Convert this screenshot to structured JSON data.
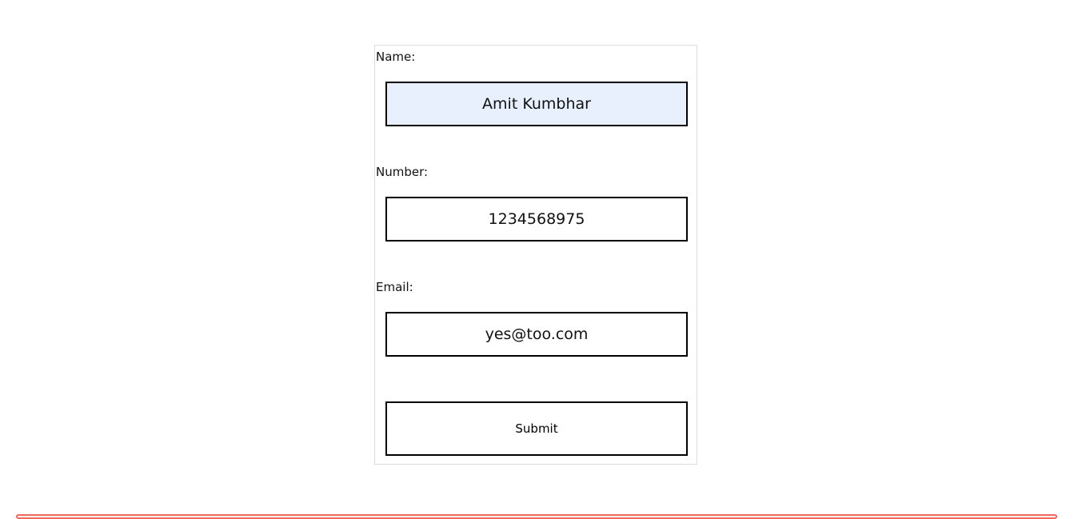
{
  "form": {
    "name_label": "Name:",
    "name_value": "Amit Kumbhar",
    "number_label": "Number:",
    "number_value": "1234568975",
    "email_label": "Email:",
    "email_value": "yes@too.com",
    "submit_label": "Submit"
  },
  "colors": {
    "autofill_background": "#e8f0fe",
    "input_border": "#000000",
    "card_border": "#dcdcdc",
    "divider": "#f06a5c"
  }
}
